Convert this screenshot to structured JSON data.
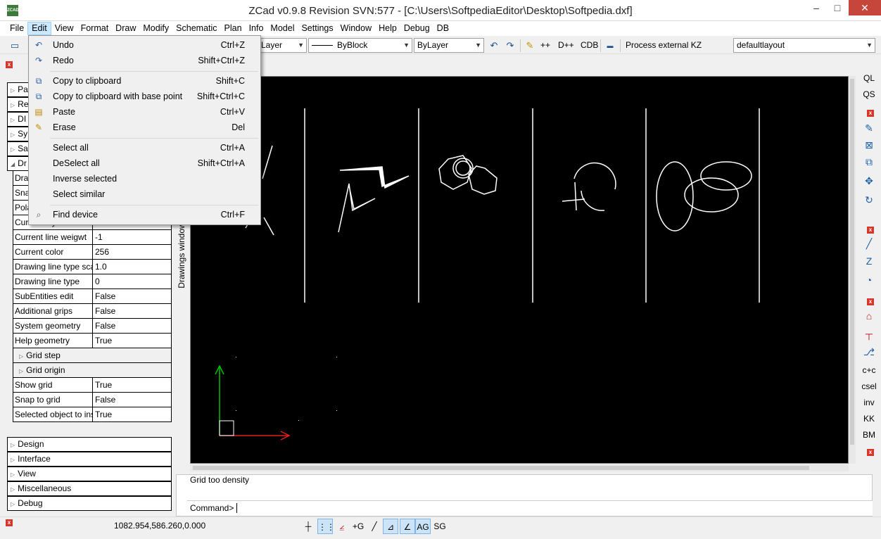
{
  "window": {
    "title": "ZCad v0.9.8 Revision SVN:577 - [C:\\Users\\SoftpediaEditor\\Desktop\\Softpedia.dxf]",
    "app_icon_text": "ZCAD",
    "minimize": "–",
    "maximize": "□",
    "close": "✕"
  },
  "menubar": [
    "File",
    "Edit",
    "View",
    "Format",
    "Draw",
    "Modify",
    "Schematic",
    "Plan",
    "Info",
    "Model",
    "Settings",
    "Window",
    "Help",
    "Debug",
    "DB"
  ],
  "edit_menu": {
    "items": [
      {
        "label": "Undo",
        "shortcut": "Ctrl+Z",
        "icon": "undo-icon"
      },
      {
        "label": "Redo",
        "shortcut": "Shift+Ctrl+Z",
        "icon": "redo-icon"
      },
      {
        "label": "Copy to clipboard",
        "shortcut": "Shift+C",
        "icon": "copy-icon"
      },
      {
        "label": "Copy to clipboard with base point",
        "shortcut": "Shift+Ctrl+C",
        "icon": "copy-base-icon"
      },
      {
        "label": "Paste",
        "shortcut": "Ctrl+V",
        "icon": "paste-icon"
      },
      {
        "label": "Erase",
        "shortcut": "Del",
        "icon": "erase-icon"
      },
      {
        "label": "Select all",
        "shortcut": "Ctrl+A",
        "icon": ""
      },
      {
        "label": "DeSelect all",
        "shortcut": "Shift+Ctrl+A",
        "icon": ""
      },
      {
        "label": "Inverse selected",
        "shortcut": "",
        "icon": ""
      },
      {
        "label": "Select similar",
        "shortcut": "",
        "icon": ""
      },
      {
        "label": "Find device",
        "shortcut": "Ctrl+F",
        "icon": "find-icon"
      }
    ]
  },
  "toolbar": {
    "layer_combo": "Layer",
    "linetype_combo": "ByBlock",
    "lineweight_combo": "ByLayer",
    "btn_pp": "++",
    "btn_dpp": "D++",
    "btn_cdb": "CDB",
    "process_kz": "Process external KZ",
    "layout_combo": "defaultlayout"
  },
  "left_panel": {
    "top_sections": [
      "Pa",
      "Re",
      "DI",
      "Sy",
      "Sa",
      "Dr"
    ],
    "props": [
      {
        "name": "Draw",
        "value": ""
      },
      {
        "name": "Snap",
        "value": ""
      },
      {
        "name": "Pola",
        "value": ""
      },
      {
        "name": "Current layer",
        "value": "0"
      },
      {
        "name": "Current line weigwt",
        "value": "-1"
      },
      {
        "name": "Current color",
        "value": "256"
      },
      {
        "name": "Drawing line type sca",
        "value": "1.0"
      },
      {
        "name": "Drawing line type",
        "value": "0"
      },
      {
        "name": "SubEntities edit",
        "value": "False"
      },
      {
        "name": "Additional grips",
        "value": "False"
      },
      {
        "name": "System geometry",
        "value": "False"
      },
      {
        "name": "Help geometry",
        "value": "True"
      }
    ],
    "subs": [
      "Grid step",
      "Grid origin"
    ],
    "props2": [
      {
        "name": "Show grid",
        "value": "True"
      },
      {
        "name": "Snap to grid",
        "value": "False"
      },
      {
        "name": "Selected object to ins",
        "value": "True"
      }
    ],
    "bottom_sections": [
      "Design",
      "Interface",
      "View",
      "Miscellaneous",
      "Debug"
    ]
  },
  "drawings_tab": "Drawings window",
  "right_tools": [
    "QL",
    "QS",
    "c+c",
    "csel",
    "inv",
    "KK",
    "BM"
  ],
  "command": {
    "message": "Grid too density",
    "prompt": "Command>"
  },
  "status": {
    "coords": "1082.954,586.260,0.000",
    "btn_g": "+G",
    "btn_ag": "AG",
    "btn_sg": "SG"
  },
  "colors": {
    "canvas_bg": "#000000",
    "axis_y": "#00c000",
    "axis_x": "#e02020",
    "close_red": "#d9362b",
    "menu_hover": "#cce8ff"
  }
}
